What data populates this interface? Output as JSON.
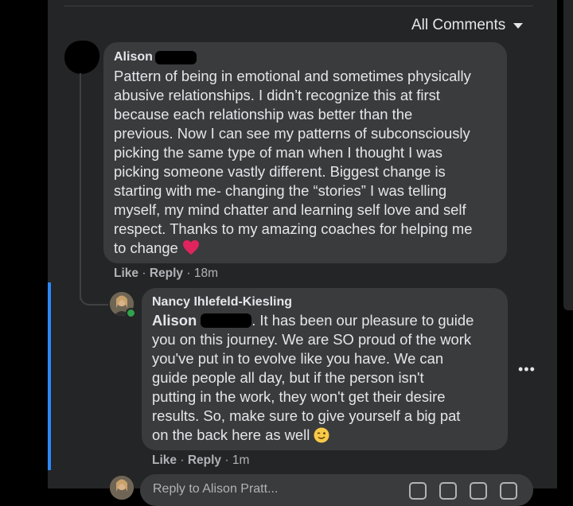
{
  "sort": {
    "label": "All Comments",
    "icon": "caret-down-icon"
  },
  "comment": {
    "author": "Alison",
    "text": "Pattern of being in emotional and sometimes physically\nabusive relationships. I didn’t recognize this at first\nbecause each relationship was better than the\nprevious. Now I can see my patterns of subconsciously\npicking the same type of man when I thought I was\npicking someone vastly different. Biggest change is\nstarting with me- changing the “stories” I was telling\nmyself, my mind chatter and learning self love and self\nrespect. Thanks to my amazing coaches for helping me\nto change",
    "emoji": "heart-emoji",
    "like": "Like",
    "reply": "Reply",
    "sep": "·",
    "time": "18m"
  },
  "reply_comment": {
    "author": "Nancy Ihlefeld-Kiesling",
    "mention": "Alison",
    "text_first": ". It has been our pleasure to guide",
    "text": "you on this journey. We are SO proud of the work\nyou've put in to evolve like you have. We can\nguide people all day, but if the person isn't\nputting in the work, they won't get their desire\nresults. So, make sure to give yourself a big pat\non the back here as well",
    "emoji": "wink-emoji",
    "like": "Like",
    "reply": "Reply",
    "sep": "·",
    "time": "1m",
    "more": "•••"
  },
  "reply_box": {
    "placeholder": "Reply to Alison Pratt..."
  },
  "colors": {
    "bubble": "#3a3b3c",
    "panel": "#242526",
    "accent": "#2d88ff",
    "online": "#31a24c",
    "heart": "#e0245e"
  }
}
